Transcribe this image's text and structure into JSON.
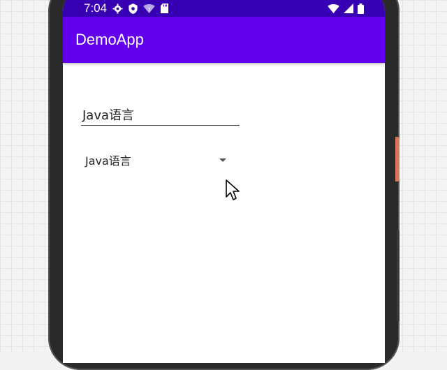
{
  "status_bar": {
    "time": "7:04",
    "icons": [
      "settings-icon",
      "shield-icon",
      "wifi-icon",
      "sd-card-icon",
      "signal-icon",
      "wifi-full-icon",
      "battery-icon"
    ]
  },
  "app_bar": {
    "title": "DemoApp"
  },
  "main": {
    "text_field_value": "Java语言",
    "spinner_selected": "Java语言"
  },
  "colors": {
    "status_bar": "#3700b3",
    "app_bar": "#6200ee",
    "screen_bg": "#ffffff"
  }
}
